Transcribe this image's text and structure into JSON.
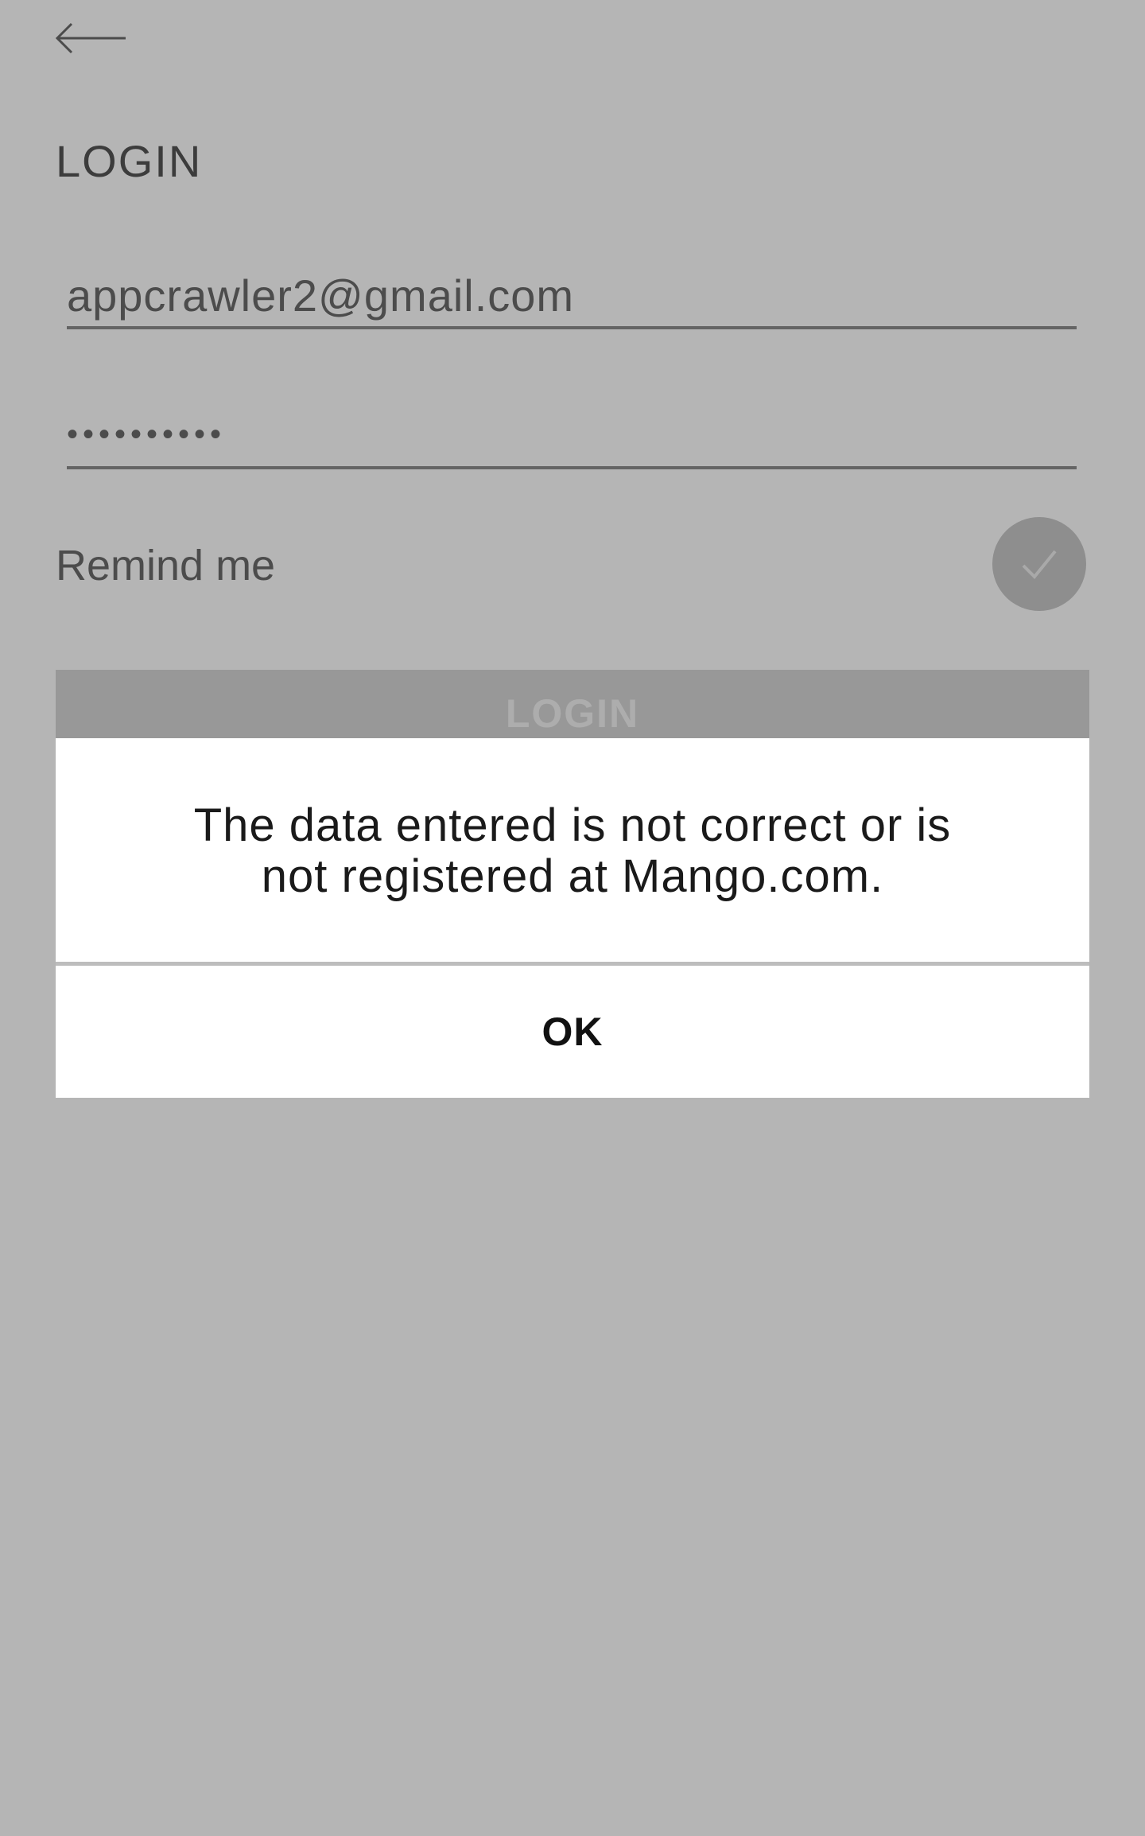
{
  "header": {
    "back_icon": "arrow-left-icon",
    "title": "LOGIN"
  },
  "form": {
    "email_value": "appcrawler2@gmail.com",
    "password_value": "••••••••••",
    "remind_label": "Remind me",
    "remind_checked": true,
    "remind_icon": "checkmark-icon",
    "login_button_label": "LOGIN"
  },
  "dialog": {
    "message_line1": "The data entered is not correct or is",
    "message_line2": "not registered at Mango.com.",
    "ok_label": "OK"
  },
  "colors": {
    "overlay": "#000000",
    "dialog_background": "#ffffff",
    "disabled_button": "#d7d7d7"
  }
}
